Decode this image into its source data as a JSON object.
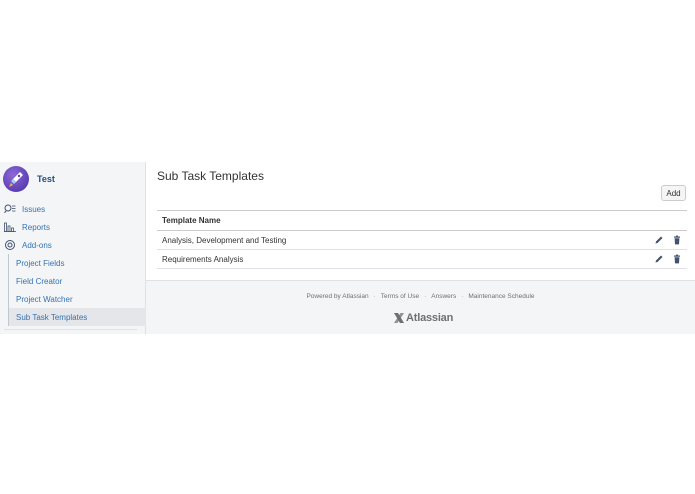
{
  "project": {
    "name": "Test",
    "avatar_icon": "rocket-icon"
  },
  "sidebar": {
    "items": [
      {
        "label": "Issues",
        "icon": "issues-search-icon"
      },
      {
        "label": "Reports",
        "icon": "reports-chart-icon"
      },
      {
        "label": "Add-ons",
        "icon": "addons-gear-icon"
      }
    ],
    "subitems": [
      {
        "label": "Project Fields"
      },
      {
        "label": "Field Creator"
      },
      {
        "label": "Project Watcher"
      },
      {
        "label": "Sub Task Templates",
        "active": true
      }
    ]
  },
  "main": {
    "title": "Sub Task Templates",
    "add_label": "Add",
    "table": {
      "headers": [
        "Template Name"
      ],
      "rows": [
        [
          "Analysis, Development and Testing"
        ],
        [
          "Requirements Analysis"
        ]
      ]
    }
  },
  "footer": {
    "links": [
      "Powered by Atlassian",
      "Terms of Use",
      "Answers",
      "Maintenance Schedule"
    ],
    "separator": "·",
    "logo_text": "Atlassian"
  },
  "colors": {
    "link": "#3572b0",
    "sidebar_bg": "#f4f5f7",
    "active_bg": "#e4e6ea"
  }
}
